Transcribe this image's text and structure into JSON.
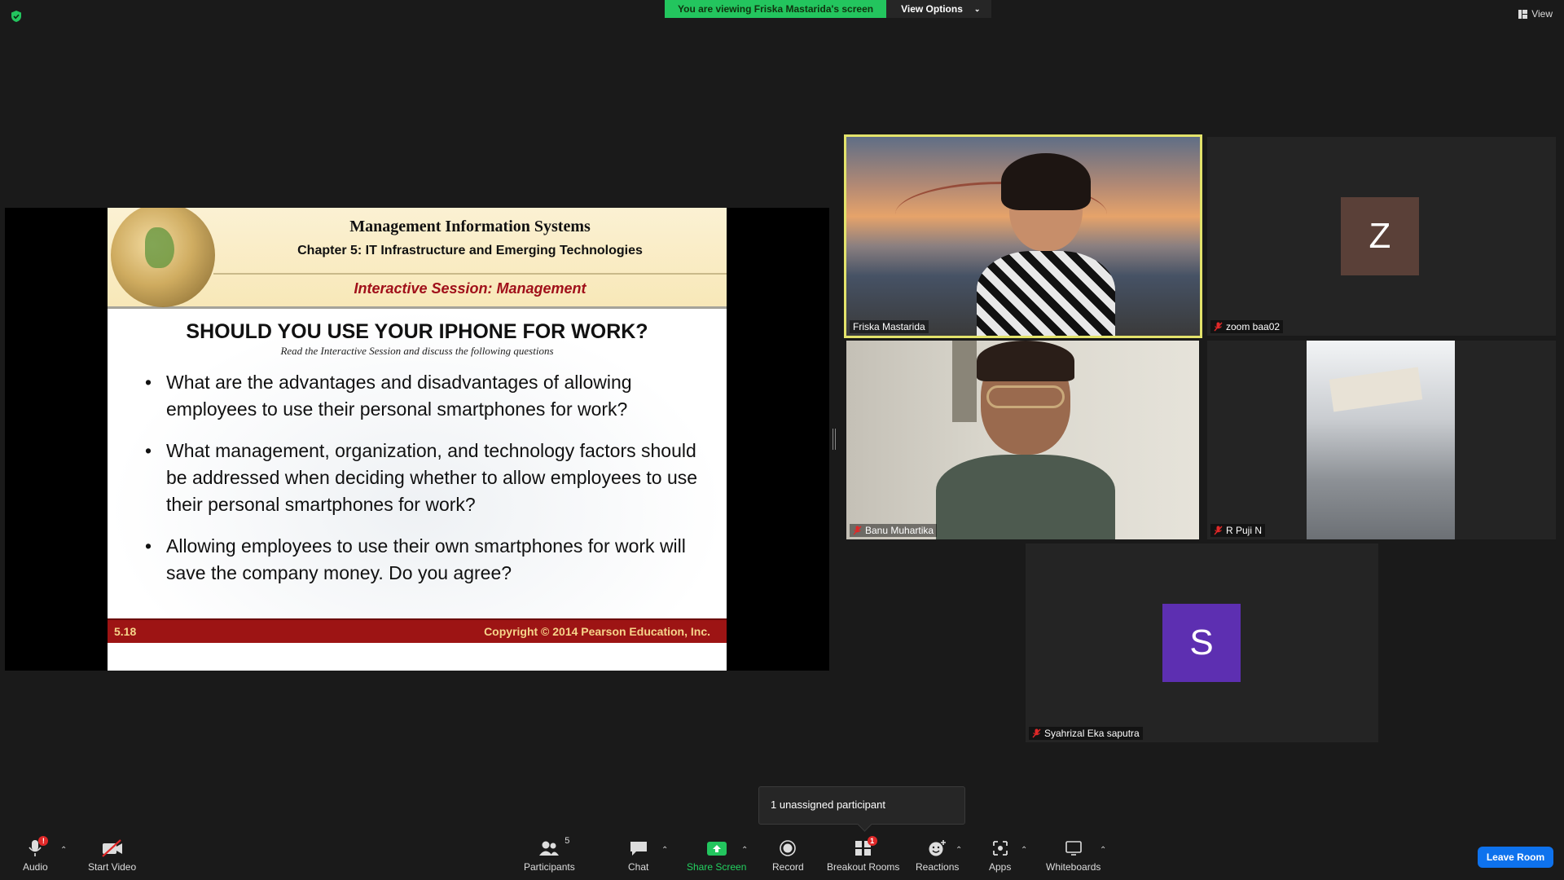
{
  "top": {
    "viewing_banner": "You are viewing Friska Mastarida's screen",
    "view_options_label": "View Options",
    "view_label": "View"
  },
  "slide": {
    "title": "Management Information Systems",
    "chapter": "Chapter 5: IT Infrastructure and Emerging Technologies",
    "session": "Interactive Session: Management",
    "heading": "SHOULD YOU USE YOUR IPHONE FOR WORK?",
    "instructions": "Read the Interactive Session and discuss the following questions",
    "bullets": [
      "What are the advantages and disadvantages of allowing employees to use their personal smartphones for work?",
      "What management, organization, and technology factors should be addressed when deciding whether to allow employees to use their personal smartphones for work?",
      "Allowing employees to use their own smartphones for work will save the company money. Do you agree?"
    ],
    "page_number": "5.18",
    "copyright": "Copyright © 2014 Pearson Education, Inc."
  },
  "participants": {
    "friska": {
      "name": "Friska Mastarida"
    },
    "zoom": {
      "name": "zoom baa02",
      "initial": "Z",
      "color": "#5a4038"
    },
    "banu": {
      "name": "Banu Muhartika"
    },
    "puji": {
      "name": "R Puji N"
    },
    "syahrizal": {
      "name": "Syahrizal Eka saputra",
      "initial": "S",
      "color": "#5d2fb1"
    }
  },
  "popup": {
    "unassigned": "1 unassigned participant"
  },
  "toolbar": {
    "audio": "Audio",
    "audio_badge": "!",
    "start_video": "Start Video",
    "participants": "Participants",
    "participants_count": "5",
    "chat": "Chat",
    "share_screen": "Share Screen",
    "record": "Record",
    "breakout_rooms": "Breakout Rooms",
    "breakout_badge": "1",
    "reactions": "Reactions",
    "apps": "Apps",
    "whiteboards": "Whiteboards",
    "leave_room": "Leave Room"
  },
  "colors": {
    "accent_green": "#23c55e",
    "leave_blue": "#0e72ed",
    "active_speaker": "#e3e36b",
    "slide_footer": "#9d1414"
  }
}
